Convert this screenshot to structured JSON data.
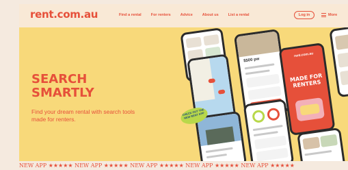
{
  "nav": {
    "logo": "rent.com.au",
    "links": [
      "Find a rental",
      "For renters",
      "Advice",
      "About us",
      "List a rental"
    ],
    "login": "Log in",
    "more": "More"
  },
  "hero": {
    "title_line1": "SEARCH",
    "title_line2": "SMARTLY",
    "subtitle": "Find your dream rental with search tools made for renters.",
    "badge": "CHECK OUT THE NEW RENT APP",
    "phone_title": "MADE FOR RENTERS",
    "phone_logo": "rent.com.au",
    "listing_price": "$500 pw"
  },
  "marquee": "NEW APP ★★★★★ NEW APP ★★★★★ NEW APP ★★★★★ NEW APP ★★★★★ NEW APP ★★★★★",
  "colors": {
    "accent": "#e6503a",
    "hero_bg": "#f8d97a",
    "page_bg": "#f5eadf",
    "badge": "#b8d84a"
  }
}
